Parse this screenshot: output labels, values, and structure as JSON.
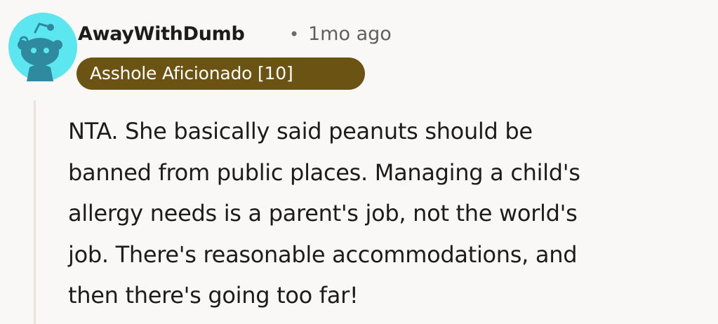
{
  "comment": {
    "author": "AwayWithDumb",
    "separator": "•",
    "timestamp": "1mo ago",
    "flair": "Asshole Aficionado [10]",
    "avatar_icon": "reddit-snoo-avatar-icon",
    "body_lines": [
      "NTA. She basically said peanuts should be",
      "banned from public places. Managing a child's",
      "allergy needs is a parent's job, not the world's",
      "job. There's reasonable accommodations, and",
      "then there's going too far!"
    ]
  },
  "colors": {
    "avatar_bg": "#5ce6f0",
    "avatar_figure": "#2f8aa0",
    "flair_bg": "#6b5413",
    "flair_text": "#ffffff",
    "thread_line": "#e6e3df"
  }
}
